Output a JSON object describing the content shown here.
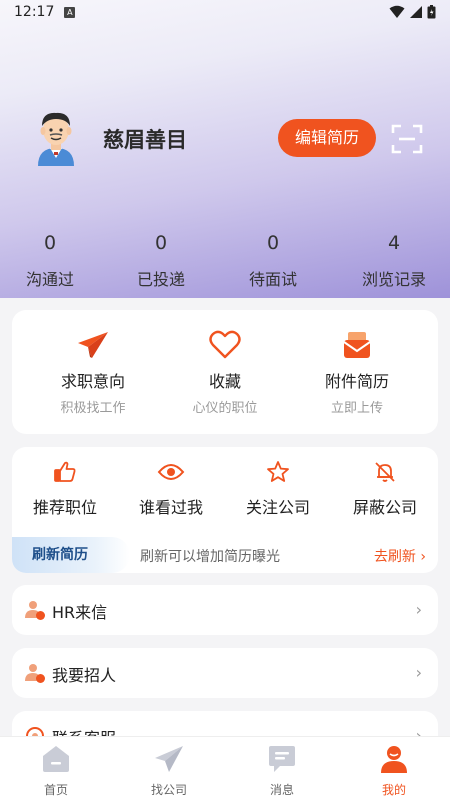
{
  "status_bar": {
    "time": "12:17"
  },
  "profile": {
    "name": "慈眉善目",
    "edit_label": "编辑简历"
  },
  "stats": [
    {
      "num": "0",
      "label": "沟通过"
    },
    {
      "num": "0",
      "label": "已投递"
    },
    {
      "num": "0",
      "label": "待面试"
    },
    {
      "num": "4",
      "label": "浏览记录"
    }
  ],
  "main_tools": [
    {
      "title": "求职意向",
      "sub": "积极找工作"
    },
    {
      "title": "收藏",
      "sub": "心仪的职位"
    },
    {
      "title": "附件简历",
      "sub": "立即上传"
    }
  ],
  "sub_tools": [
    {
      "title": "推荐职位"
    },
    {
      "title": "谁看过我"
    },
    {
      "title": "关注公司"
    },
    {
      "title": "屏蔽公司"
    }
  ],
  "refresh": {
    "tag": "刷新简历",
    "desc": "刷新可以增加简历曝光",
    "action": "去刷新 ›"
  },
  "rows": [
    {
      "label": "HR来信"
    },
    {
      "label": "我要招人"
    },
    {
      "label": "联系客服"
    }
  ],
  "tabs": [
    {
      "label": "首页"
    },
    {
      "label": "找公司"
    },
    {
      "label": "消息"
    },
    {
      "label": "我的"
    }
  ],
  "colors": {
    "accent": "#f0531f",
    "refresh_text": "#1e4f8a"
  }
}
